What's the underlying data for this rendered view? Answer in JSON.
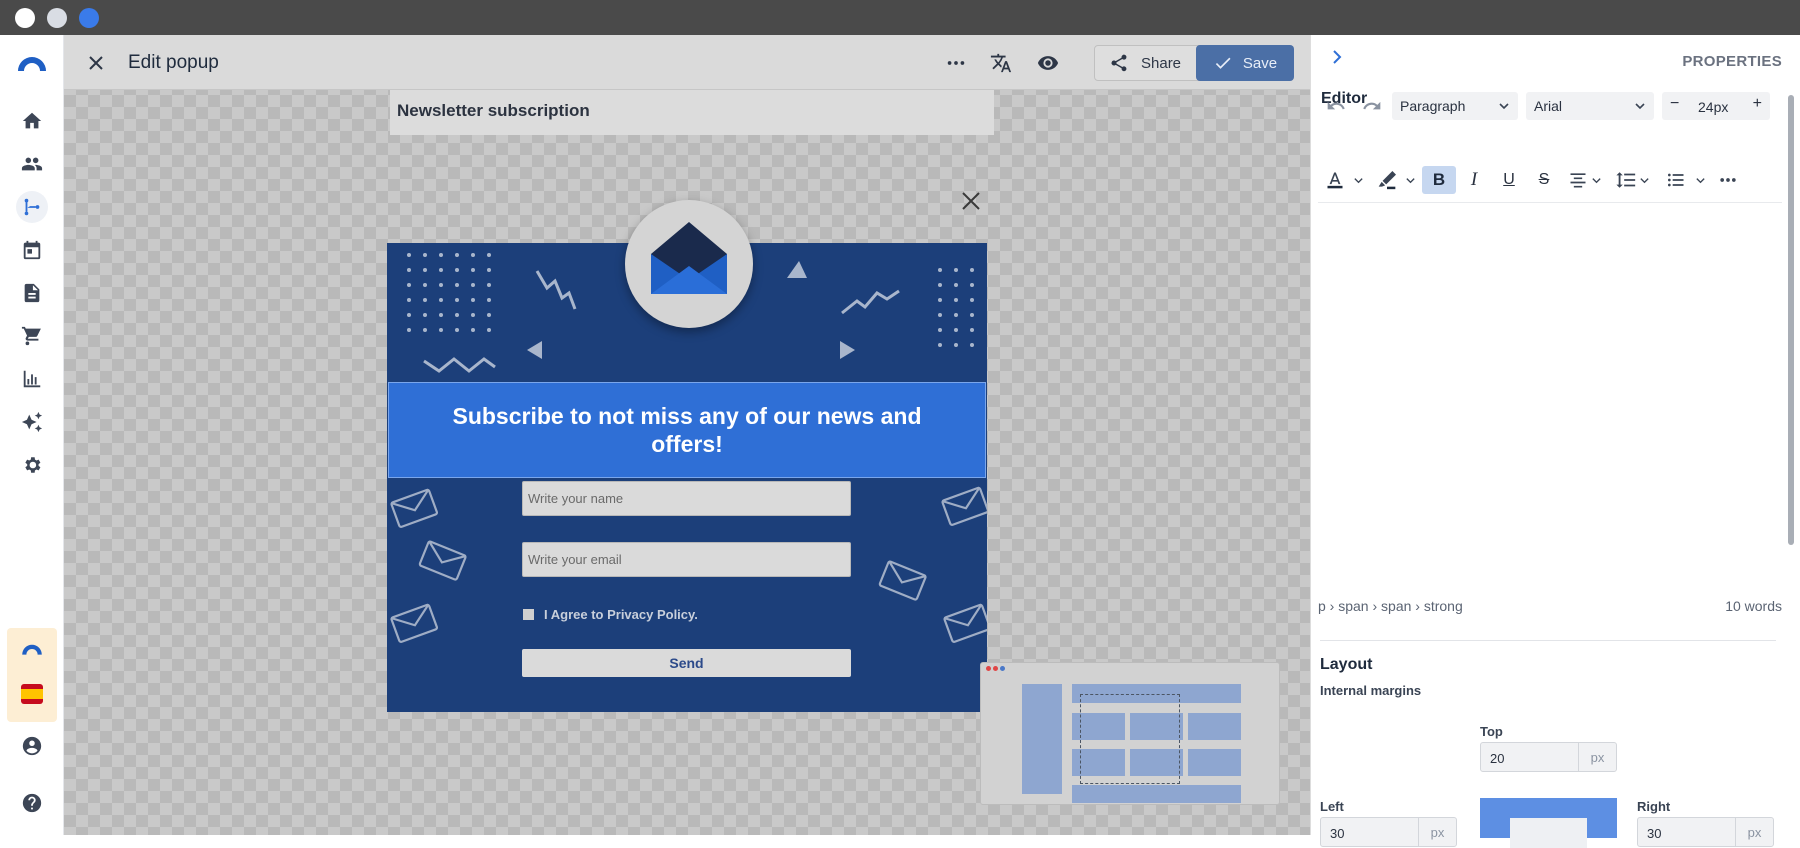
{
  "window": {
    "controls": [
      {
        "name": "close",
        "color": "#ffffff"
      },
      {
        "name": "minimize",
        "color": "#d9dde4"
      },
      {
        "name": "maximize",
        "color": "#3a7bea"
      }
    ]
  },
  "rail": {
    "items": [
      "logo-icon",
      "home-icon",
      "contacts-icon",
      "automation-icon",
      "calendar-icon",
      "document-icon",
      "cart-icon",
      "chart-icon",
      "sparkles-icon",
      "settings-icon",
      "account-icon",
      "help-icon"
    ],
    "selected": "automation-icon"
  },
  "topbar": {
    "title": "Edit popup",
    "share_label": "Share",
    "save_label": "Save"
  },
  "canvas": {
    "page_label": "Newsletter subscription"
  },
  "popup": {
    "headline": "Subscribe to not miss any of our news and offers!",
    "name_placeholder": "Write your name",
    "email_placeholder": "Write your email",
    "agree_label": "I Agree to Privacy Policy.",
    "send_label": "Send",
    "colors": {
      "background": "#1c3f7a",
      "banner": "#2f6fd6"
    }
  },
  "panel": {
    "title": "PROPERTIES",
    "editor_label": "Editor",
    "block_format": "Paragraph",
    "font": "Arial",
    "font_size": "24px",
    "path": "p › span › span › strong",
    "word_count": "10 words",
    "layout_label": "Layout",
    "internal_margins_label": "Internal margins",
    "top_label": "Top",
    "top_value": "20",
    "top_unit": "px",
    "left_label": "Left",
    "left_value": "30",
    "left_unit": "px",
    "right_label": "Right",
    "right_value": "30",
    "right_unit": "px"
  }
}
